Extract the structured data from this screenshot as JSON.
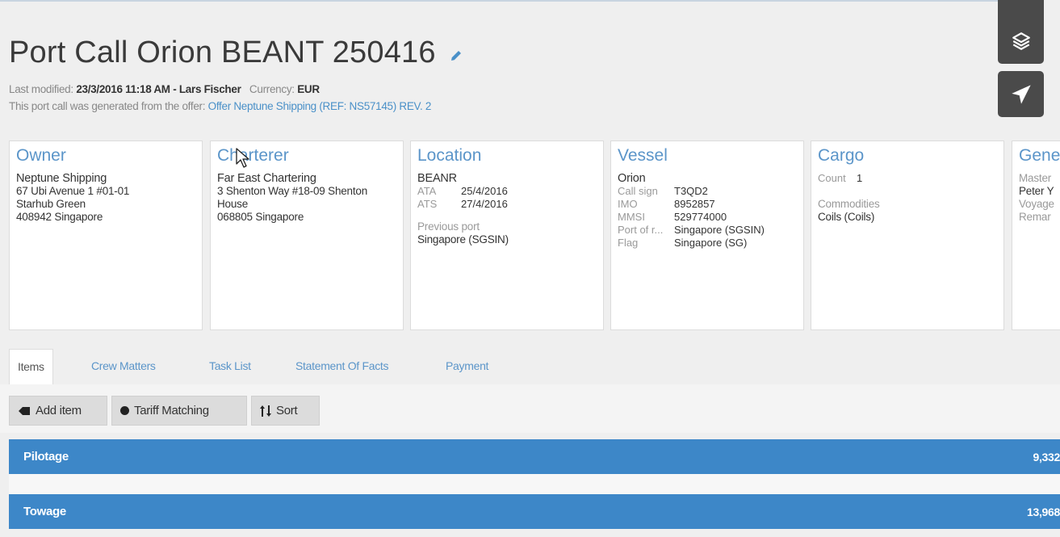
{
  "header": {
    "title": "Port Call Orion BEANT 250416",
    "modified_label": "Last modified:",
    "modified_value": "23/3/2016 11:18 AM - Lars Fischer",
    "currency_label": "Currency:",
    "currency_value": "EUR",
    "offer_text": "This port call was generated from the offer:",
    "offer_link": "Offer Neptune Shipping (REF: NS57145) REV. 2"
  },
  "cards": {
    "owner": {
      "title": "Owner",
      "name": "Neptune Shipping",
      "address1": "67 Ubi Avenue 1 #01-01",
      "address2": "Starhub Green",
      "address3": "408942 Singapore"
    },
    "charterer": {
      "title": "Charterer",
      "name": "Far East Chartering",
      "address1": "3 Shenton Way #18-09 Shenton",
      "address2": "House",
      "address3": "068805 Singapore"
    },
    "location": {
      "title": "Location",
      "code": "BEANR",
      "ata_label": "ATA",
      "ata_value": "25/4/2016",
      "ats_label": "ATS",
      "ats_value": "27/4/2016",
      "prev_label": "Previous port",
      "prev_value": "Singapore (SGSIN)"
    },
    "vessel": {
      "title": "Vessel",
      "name": "Orion",
      "callsign_label": "Call sign",
      "callsign_value": "T3QD2",
      "imo_label": "IMO",
      "imo_value": "8952857",
      "mmsi_label": "MMSI",
      "mmsi_value": "529774000",
      "port_label": "Port of r...",
      "port_value": "Singapore (SGSIN)",
      "flag_label": "Flag",
      "flag_value": "Singapore (SG)"
    },
    "cargo": {
      "title": "Cargo",
      "count_label": "Count",
      "count_value": "1",
      "commodities_label": "Commodities",
      "commodities_value": "Coils (Coils)"
    },
    "general": {
      "title": "Gene",
      "master_label": "Master",
      "master_value": "Peter Y",
      "voyage_label": "Voyage",
      "remarks_label": "Remar"
    }
  },
  "tabs": [
    "Items",
    "Crew Matters",
    "Task List",
    "Statement Of Facts",
    "Payment"
  ],
  "toolbar": {
    "add_item": "Add item",
    "tariff": "Tariff Matching",
    "sort": "Sort"
  },
  "items": [
    {
      "label": "Pilotage",
      "amount": "9,332"
    },
    {
      "label": "Towage",
      "amount": "13,968"
    }
  ],
  "colors": {
    "accent": "#3d87c8",
    "link": "#5b95c9",
    "side_button": "#4a4a4a"
  },
  "icons": [
    "edit-pencil-icon",
    "layers-icon",
    "send-icon",
    "tag-icon",
    "circle-icon",
    "sort-icon",
    "cursor-arrow-icon"
  ]
}
